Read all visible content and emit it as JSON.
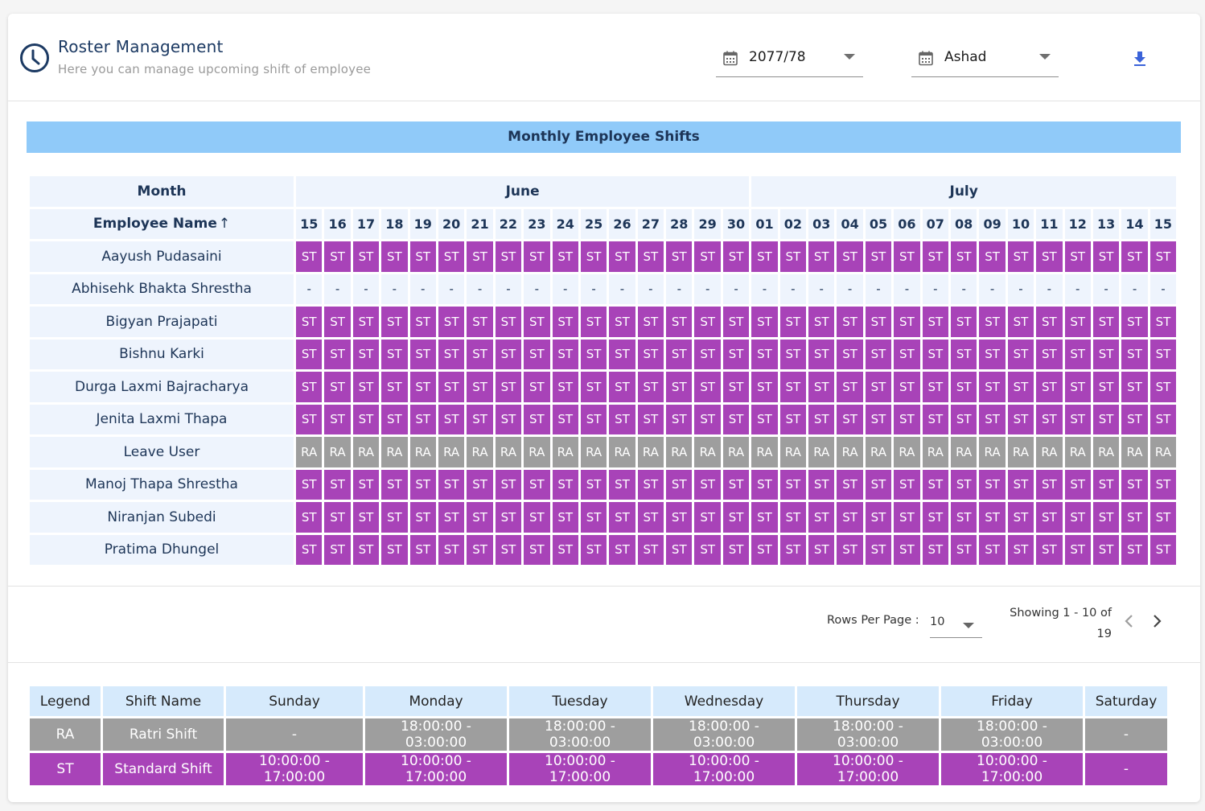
{
  "header": {
    "title": "Roster Management",
    "subtitle": "Here you can manage upcoming shift of employee",
    "icon": "clock-icon",
    "fiscal_year_select": {
      "value": "2077/78",
      "icon": "calendar-icon"
    },
    "month_select": {
      "value": "Ashad",
      "icon": "calendar-icon"
    },
    "download_icon": "download-icon"
  },
  "banner": {
    "title": "Monthly Employee Shifts"
  },
  "roster": {
    "month_header_label": "Month",
    "employee_header_label": "Employee Name",
    "sort_indicator": "↑",
    "months": [
      {
        "name": "June",
        "days": [
          "15",
          "16",
          "17",
          "18",
          "19",
          "20",
          "21",
          "22",
          "23",
          "24",
          "25",
          "26",
          "27",
          "28",
          "29",
          "30"
        ]
      },
      {
        "name": "July",
        "days": [
          "01",
          "02",
          "03",
          "04",
          "05",
          "06",
          "07",
          "08",
          "09",
          "10",
          "11",
          "12",
          "13",
          "14",
          "15"
        ]
      }
    ],
    "rows": [
      {
        "name": "Aayush Pudasaini",
        "shift": "ST"
      },
      {
        "name": "Abhisehk Bhakta Shrestha",
        "shift": "-"
      },
      {
        "name": "Bigyan Prajapati",
        "shift": "ST"
      },
      {
        "name": "Bishnu Karki",
        "shift": "ST"
      },
      {
        "name": "Durga Laxmi Bajracharya",
        "shift": "ST"
      },
      {
        "name": "Jenita Laxmi Thapa",
        "shift": "ST"
      },
      {
        "name": "Leave User",
        "shift": "RA"
      },
      {
        "name": "Manoj Thapa Shrestha",
        "shift": "ST"
      },
      {
        "name": "Niranjan Subedi",
        "shift": "ST"
      },
      {
        "name": "Pratima Dhungel",
        "shift": "ST"
      }
    ]
  },
  "pagination": {
    "rows_per_page_label": "Rows Per Page :",
    "rows_per_page_value": "10",
    "showing_text": "Showing 1 - 10 of 19",
    "prev_icon": "chevron-left-icon",
    "next_icon": "chevron-right-icon"
  },
  "legend_table": {
    "headers": [
      "Legend",
      "Shift Name",
      "Sunday",
      "Monday",
      "Tuesday",
      "Wednesday",
      "Thursday",
      "Friday",
      "Saturday"
    ],
    "rows": [
      {
        "code": "RA",
        "cells": [
          "RA",
          "Ratri Shift",
          "-",
          "18:00:00 - 03:00:00",
          "18:00:00 - 03:00:00",
          "18:00:00 - 03:00:00",
          "18:00:00 - 03:00:00",
          "18:00:00 - 03:00:00",
          "-"
        ]
      },
      {
        "code": "ST",
        "cells": [
          "ST",
          "Standard Shift",
          "10:00:00 - 17:00:00",
          "10:00:00 - 17:00:00",
          "10:00:00 - 17:00:00",
          "10:00:00 - 17:00:00",
          "10:00:00 - 17:00:00",
          "10:00:00 - 17:00:00",
          "-"
        ]
      }
    ]
  },
  "colors": {
    "standard_shift": "#a843b8",
    "ratri_shift": "#9e9e9e",
    "banner": "#90caf9",
    "table_cell_bg": "#eef4fd",
    "legend_header_bg": "#d6eafc",
    "title": "#1c3a63",
    "download_icon": "#3b63d9"
  }
}
